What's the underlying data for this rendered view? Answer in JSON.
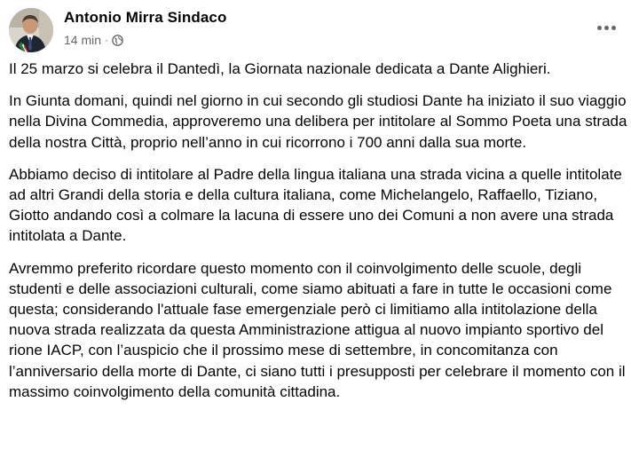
{
  "post": {
    "author": "Antonio Mirra Sindaco",
    "timestamp": "14 min",
    "separator": "·",
    "audience_icon": "globe-icon",
    "more_icon": "more-options-icon",
    "paragraphs": [
      "Il 25 marzo si celebra il Dantedì, la Giornata nazionale dedicata a Dante Alighieri.",
      "In Giunta domani, quindi nel giorno in cui secondo gli studiosi Dante ha iniziato il suo viaggio nella Divina Commedia, approveremo una delibera per intitolare al Sommo Poeta una strada della nostra Città, proprio nell’anno in cui ricorrono i 700 anni dalla sua morte.",
      "Abbiamo deciso di intitolare al Padre della lingua italiana una strada vicina a quelle intitolate ad altri Grandi della storia e della cultura italiana, come Michelangelo, Raffaello, Tiziano, Giotto andando così a colmare la lacuna di essere uno dei Comuni a non avere una strada intitolata a Dante.",
      "Avremmo preferito ricordare questo momento con il coinvolgimento delle scuole, degli studenti e delle associazioni culturali, come siamo abituati a fare in tutte le occasioni come questa; considerando l'attuale fase emergenziale però ci limitiamo alla intitolazione della nuova strada realizzata da questa Amministrazione attigua al nuovo impianto sportivo del rione IACP, con l’auspicio che il prossimo mese di settembre, in concomitanza con l’anniversario della morte di Dante, ci siano tutti i presupposti per celebrare il momento con il massimo coinvolgimento della comunità cittadina."
    ]
  },
  "colors": {
    "text_primary": "#050505",
    "text_secondary": "#65676b",
    "background": "#ffffff"
  }
}
